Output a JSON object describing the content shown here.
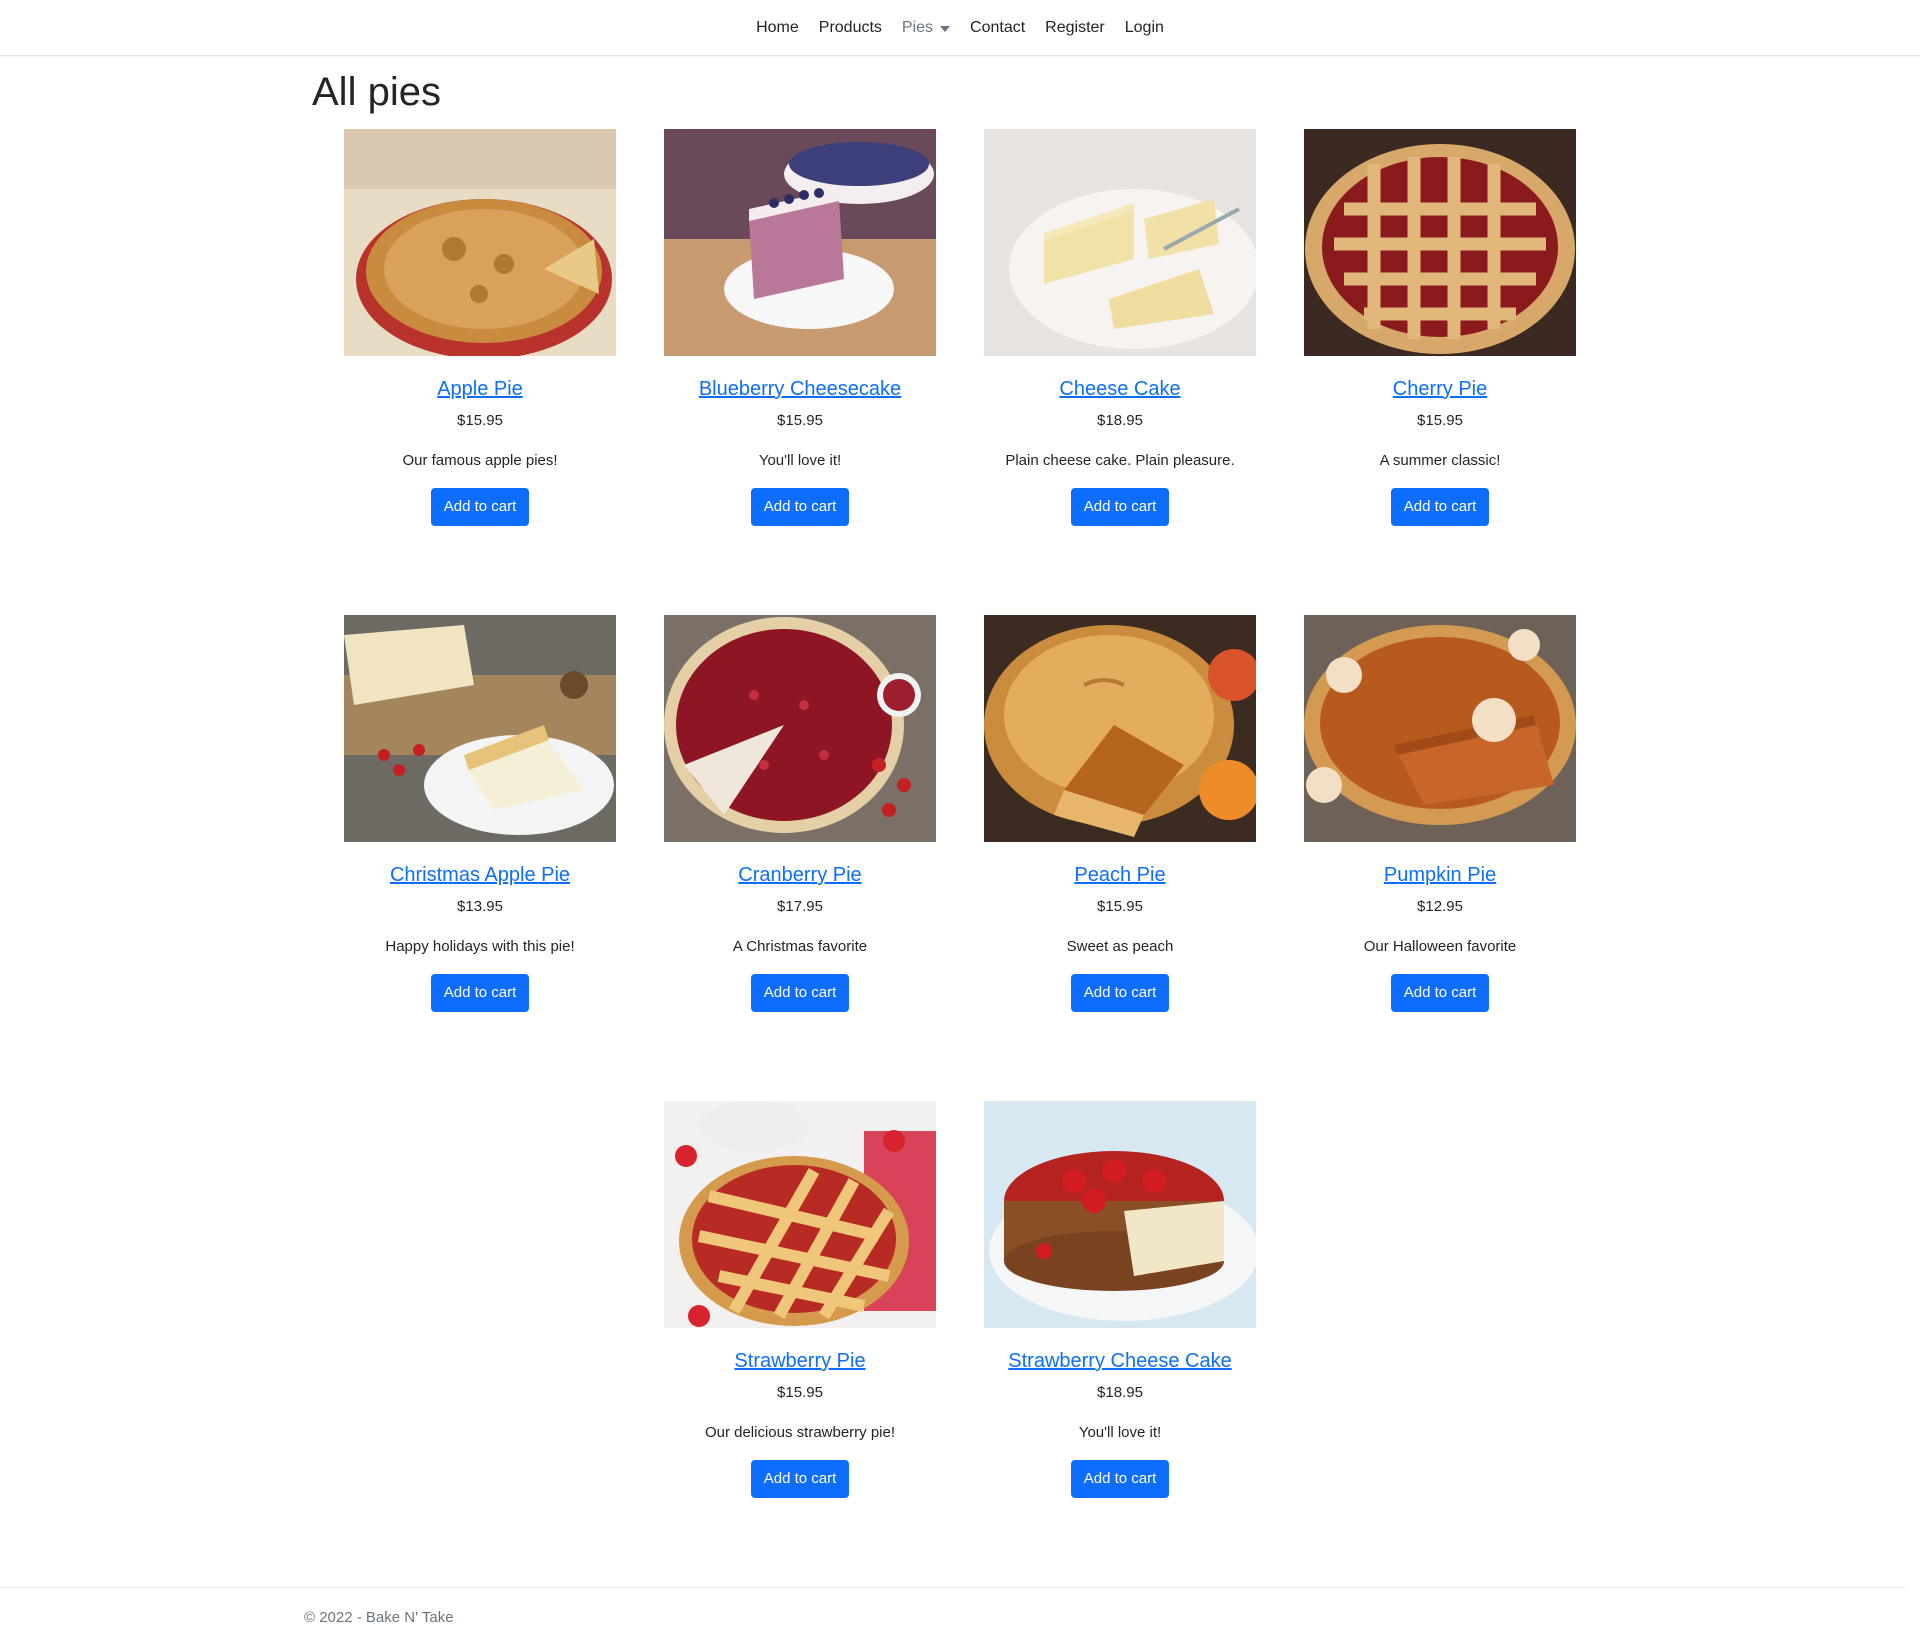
{
  "nav": {
    "items": [
      {
        "label": "Home"
      },
      {
        "label": "Products"
      },
      {
        "label": "Pies"
      },
      {
        "label": "Contact"
      },
      {
        "label": "Register"
      },
      {
        "label": "Login"
      }
    ]
  },
  "page": {
    "title": "All pies"
  },
  "pies": [
    {
      "name": "Apple Pie",
      "price": "$15.95",
      "description": "Our famous apple pies!",
      "button": "Add to cart",
      "image": "apple-pie-image"
    },
    {
      "name": "Blueberry Cheesecake",
      "price": "$15.95",
      "description": "You'll love it!",
      "button": "Add to cart",
      "image": "blueberry-cheesecake-image"
    },
    {
      "name": "Cheese Cake",
      "price": "$18.95",
      "description": "Plain cheese cake. Plain pleasure.",
      "button": "Add to cart",
      "image": "cheese-cake-image"
    },
    {
      "name": "Cherry Pie",
      "price": "$15.95",
      "description": "A summer classic!",
      "button": "Add to cart",
      "image": "cherry-pie-image"
    },
    {
      "name": "Christmas Apple Pie",
      "price": "$13.95",
      "description": "Happy holidays with this pie!",
      "button": "Add to cart",
      "image": "christmas-apple-pie-image"
    },
    {
      "name": "Cranberry Pie",
      "price": "$17.95",
      "description": "A Christmas favorite",
      "button": "Add to cart",
      "image": "cranberry-pie-image"
    },
    {
      "name": "Peach Pie",
      "price": "$15.95",
      "description": "Sweet as peach",
      "button": "Add to cart",
      "image": "peach-pie-image"
    },
    {
      "name": "Pumpkin Pie",
      "price": "$12.95",
      "description": "Our Halloween favorite",
      "button": "Add to cart",
      "image": "pumpkin-pie-image"
    },
    {
      "name": "Strawberry Pie",
      "price": "$15.95",
      "description": "Our delicious strawberry pie!",
      "button": "Add to cart",
      "image": "strawberry-pie-image"
    },
    {
      "name": "Strawberry Cheese Cake",
      "price": "$18.95",
      "description": "You'll love it!",
      "button": "Add to cart",
      "image": "strawberry-cheese-cake-image"
    }
  ],
  "footer": {
    "text": "© 2022 - Bake N' Take"
  },
  "colors": {
    "link": "#0d6efd",
    "button": "#0d6efd",
    "text": "#212529",
    "muted": "#6c757d"
  }
}
